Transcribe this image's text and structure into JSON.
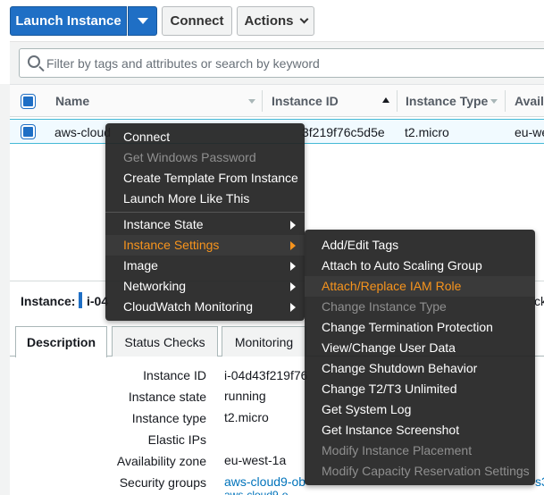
{
  "toolbar": {
    "launch_label": "Launch Instance",
    "connect_label": "Connect",
    "actions_label": "Actions"
  },
  "search": {
    "placeholder": "Filter by tags and attributes or search by keyword"
  },
  "table": {
    "columns": [
      "Name",
      "Instance ID",
      "Instance Type",
      "Avail"
    ],
    "rows": [
      {
        "name_prefix": "aws-cloud",
        "instance_id": "3f219f76c5d5e",
        "instance_type": "t2.micro",
        "availability_zone": "eu-wes"
      }
    ]
  },
  "details": {
    "instance_label": "Instance:",
    "instance_id_short": "i-04",
    "right_cut": "ck",
    "tabs": [
      "Description",
      "Status Checks",
      "Monitoring"
    ],
    "fields": [
      {
        "label": "Instance ID",
        "value": "i-04d43f219f76"
      },
      {
        "label": "Instance state",
        "value": "running"
      },
      {
        "label": "Instance type",
        "value": "t2.micro"
      },
      {
        "label": "Elastic IPs",
        "value": ""
      },
      {
        "label": "Availability zone",
        "value": "eu-west-1a"
      },
      {
        "label": "Security groups",
        "value": "aws-cloud9-ob"
      }
    ],
    "security_group_extra": "aws-cloud9-o",
    "security_group_tail": "s3"
  },
  "context_menu": {
    "items": [
      {
        "label": "Connect",
        "disabled": false,
        "submenu": false
      },
      {
        "label": "Get Windows Password",
        "disabled": true,
        "submenu": false
      },
      {
        "label": "Create Template From Instance",
        "disabled": false,
        "submenu": false
      },
      {
        "label": "Launch More Like This",
        "disabled": false,
        "submenu": false
      },
      {
        "label": "Instance State",
        "disabled": false,
        "submenu": true
      },
      {
        "label": "Instance Settings",
        "disabled": false,
        "submenu": true,
        "highlighted": true
      },
      {
        "label": "Image",
        "disabled": false,
        "submenu": true
      },
      {
        "label": "Networking",
        "disabled": false,
        "submenu": true
      },
      {
        "label": "CloudWatch Monitoring",
        "disabled": false,
        "submenu": true
      }
    ]
  },
  "submenu": {
    "items": [
      {
        "label": "Add/Edit Tags",
        "disabled": false
      },
      {
        "label": "Attach to Auto Scaling Group",
        "disabled": false
      },
      {
        "label": "Attach/Replace IAM Role",
        "disabled": false,
        "highlighted": true
      },
      {
        "label": "Change Instance Type",
        "disabled": true
      },
      {
        "label": "Change Termination Protection",
        "disabled": false
      },
      {
        "label": "View/Change User Data",
        "disabled": false
      },
      {
        "label": "Change Shutdown Behavior",
        "disabled": false
      },
      {
        "label": "Change T2/T3 Unlimited",
        "disabled": false
      },
      {
        "label": "Get System Log",
        "disabled": false
      },
      {
        "label": "Get Instance Screenshot",
        "disabled": false
      },
      {
        "label": "Modify Instance Placement",
        "disabled": true
      },
      {
        "label": "Modify Capacity Reservation Settings",
        "disabled": true
      }
    ]
  },
  "colors": {
    "primary": "#1f6fc5",
    "menu_bg": "#222222",
    "menu_highlight_text": "#f7941d",
    "link": "#0073bb"
  }
}
